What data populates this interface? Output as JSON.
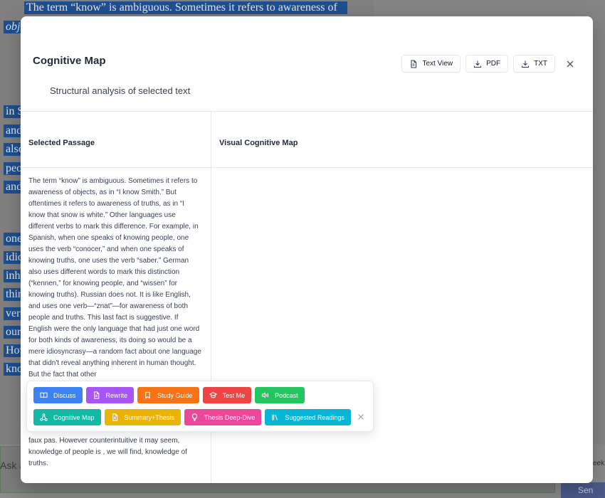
{
  "background": {
    "line1": "The term “know” is ambiguous. Sometimes it refers to awareness of",
    "line2": "obj",
    "fragments": [
      "in S",
      "and",
      "also",
      "peo",
      "and",
      "one",
      "idio",
      "inh",
      "thin",
      "ver",
      "our",
      "How",
      "kno"
    ],
    "input_placeholder": "Ask a",
    "send_label": "Sen",
    "side_text": "eek"
  },
  "modal": {
    "title": "Cognitive Map",
    "subtitle": "Structural analysis of selected text",
    "actions": [
      {
        "label": "Text View",
        "icon": "document-icon"
      },
      {
        "label": "PDF",
        "icon": "download-icon"
      },
      {
        "label": "TXT",
        "icon": "download-icon"
      }
    ],
    "columns": {
      "left_header": "Selected Passage",
      "right_header": "Visual Cognitive Map"
    },
    "passage": "The term “know” is ambiguous. Sometimes it refers to awareness of objects, as in “I know Smith.” But oftentimes it refers to awareness of truths,  as in “I know that snow is white.”  Other languages use different verbs to mark this difference. For example, in Spanish, when one speaks of knowing people, one uses the verb “conocer,” and when one speaks of knowing truths, one uses the verb “saber.” German also uses different words to mark this distinction (“kennen,” for knowing people, and “wissen” for knowing truths). Russian does not. It is like English, and uses one verb—“znat”—for awareness of both people and truths.  This last fact is suggestive. If English were the only language that had just one word for both kinds of awareness, its doing so would be a mere idiosyncrasy—a random fact about one language that didn't reveal anything inherent in human thought. But the fact that other",
    "passage_tail": "faux pas. However counterintuitive it may seem, knowledge of people is , we will find, knowledge of truths."
  },
  "toolbar": {
    "row1": [
      {
        "label": "Discuss",
        "color": "#3b82f6",
        "icon": "book-icon"
      },
      {
        "label": "Rewrite",
        "color": "#a855f7",
        "icon": "document-icon"
      },
      {
        "label": "Study Guide",
        "color": "#f97316",
        "icon": "bookmark-icon"
      },
      {
        "label": "Test Me",
        "color": "#ef4444",
        "icon": "graduation-cap-icon"
      },
      {
        "label": "Podcast",
        "color": "#22c55e",
        "icon": "speaker-icon"
      }
    ],
    "row2": [
      {
        "label": "Cognitive Map",
        "color": "#14b8a6",
        "icon": "network-icon"
      },
      {
        "label": "Summary+Thesis",
        "color": "#eab308",
        "icon": "document-icon"
      },
      {
        "label": "Thesis Deep-Dive",
        "color": "#ec4899",
        "icon": "lightbulb-icon"
      },
      {
        "label": "Suggested Readings",
        "color": "#06b6d4",
        "icon": "library-icon"
      }
    ]
  }
}
